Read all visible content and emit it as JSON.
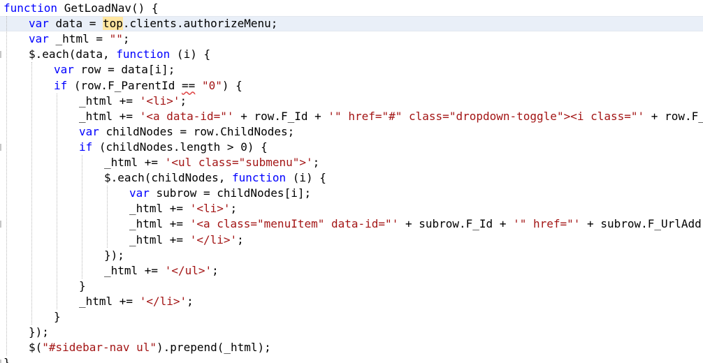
{
  "editor": {
    "lines": [
      [
        [
          "kw",
          "function"
        ],
        [
          "id",
          " GetLoadNav() {"
        ]
      ],
      [
        [
          "kw",
          "var"
        ],
        [
          "id",
          " data = "
        ],
        [
          "hl",
          "top"
        ],
        [
          "id",
          ".clients.authorizeMenu;"
        ]
      ],
      [
        [
          "kw",
          "var"
        ],
        [
          "id",
          " _html = "
        ],
        [
          "str",
          "\"\""
        ],
        [
          "id",
          ";"
        ]
      ],
      [
        [
          "id",
          "$.each(data, "
        ],
        [
          "kw",
          "function"
        ],
        [
          "id",
          " (i) {"
        ]
      ],
      [
        [
          "kw",
          "var"
        ],
        [
          "id",
          " row = data[i];"
        ]
      ],
      [
        [
          "kw",
          "if"
        ],
        [
          "id",
          " (row.F_ParentId "
        ],
        [
          "sq",
          "=="
        ],
        [
          "id",
          " "
        ],
        [
          "str",
          "\"0\""
        ],
        [
          "id",
          ") {"
        ]
      ],
      [
        [
          "id",
          "_html += "
        ],
        [
          "str",
          "'<li>'"
        ],
        [
          "id",
          ";"
        ]
      ],
      [
        [
          "id",
          "_html += "
        ],
        [
          "str",
          "'<a data-id=\"'"
        ],
        [
          "id",
          " + row.F_Id + "
        ],
        [
          "str",
          "'\" href=\"#\" class=\"dropdown-toggle\"><i class=\"'"
        ],
        [
          "id",
          " + row.F_Icon +"
        ]
      ],
      [
        [
          "kw",
          "var"
        ],
        [
          "id",
          " childNodes = row.ChildNodes;"
        ]
      ],
      [
        [
          "kw",
          "if"
        ],
        [
          "id",
          " (childNodes.length > 0) {"
        ]
      ],
      [
        [
          "id",
          "_html += "
        ],
        [
          "str",
          "'<ul class=\"submenu\">'"
        ],
        [
          "id",
          ";"
        ]
      ],
      [
        [
          "id",
          "$.each(childNodes, "
        ],
        [
          "kw",
          "function"
        ],
        [
          "id",
          " (i) {"
        ]
      ],
      [
        [
          "kw",
          "var"
        ],
        [
          "id",
          " subrow = childNodes[i];"
        ]
      ],
      [
        [
          "id",
          "_html += "
        ],
        [
          "str",
          "'<li>'"
        ],
        [
          "id",
          ";"
        ]
      ],
      [
        [
          "id",
          "_html += "
        ],
        [
          "str",
          "'<a class=\"menuItem\" data-id=\"'"
        ],
        [
          "id",
          " + subrow.F_Id + "
        ],
        [
          "str",
          "'\" href=\"'"
        ],
        [
          "id",
          " + subrow.F_UrlAddress +"
        ]
      ],
      [
        [
          "id",
          "_html += "
        ],
        [
          "str",
          "'</li>'"
        ],
        [
          "id",
          ";"
        ]
      ],
      [
        [
          "id",
          "});"
        ]
      ],
      [
        [
          "id",
          "_html += "
        ],
        [
          "str",
          "'</ul>'"
        ],
        [
          "id",
          ";"
        ]
      ],
      [
        [
          "id",
          "}"
        ]
      ],
      [
        [
          "id",
          "_html += "
        ],
        [
          "str",
          "'</li>'"
        ],
        [
          "id",
          ";"
        ]
      ],
      [
        [
          "id",
          "}"
        ]
      ],
      [
        [
          "id",
          "});"
        ]
      ],
      [
        [
          "id",
          "$("
        ],
        [
          "str",
          "\"#sidebar-nav ul\""
        ],
        [
          "id",
          ").prepend(_html);"
        ]
      ],
      [
        [
          "id",
          "}"
        ]
      ]
    ]
  }
}
